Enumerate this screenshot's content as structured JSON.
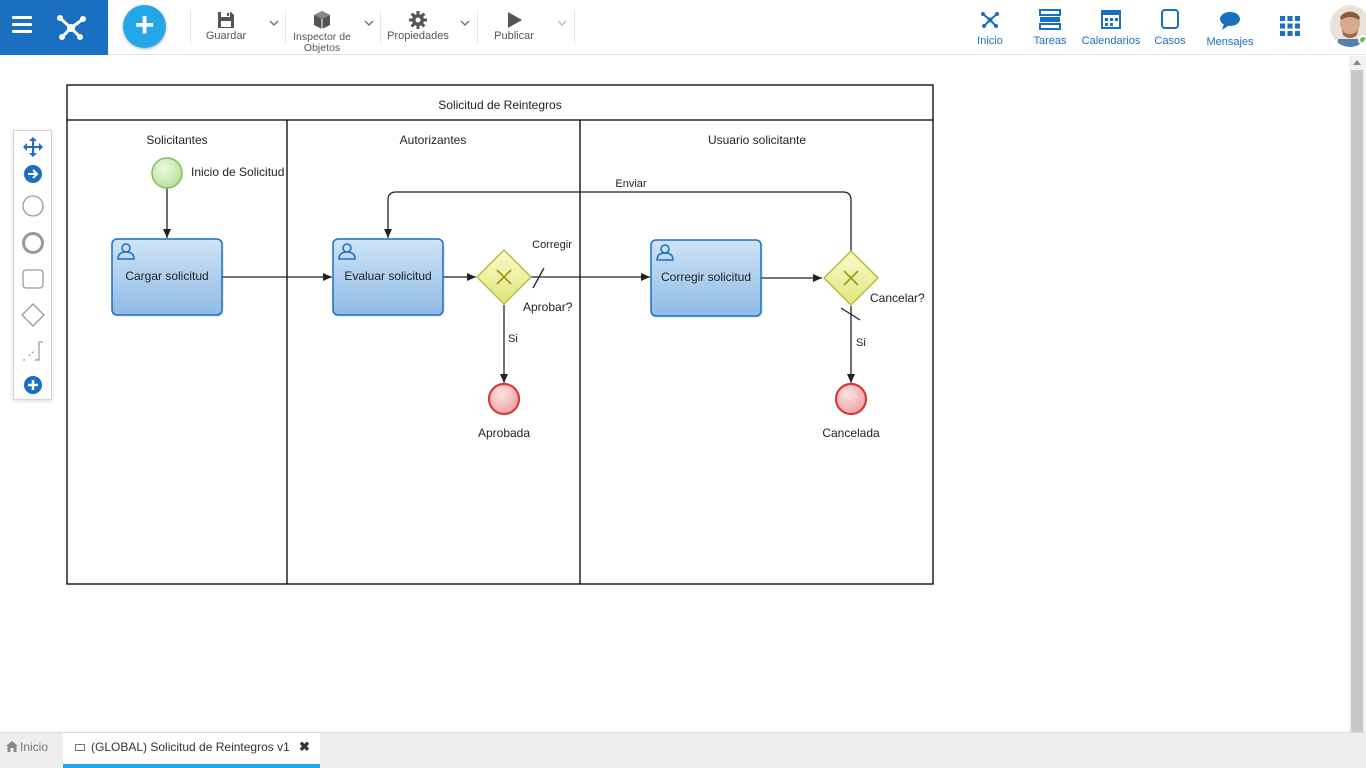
{
  "toolbar": {
    "save_label": "Guardar",
    "inspector_label": "Inspector de Objetos",
    "properties_label": "Propiedades",
    "publish_label": "Publicar",
    "add_label": "+"
  },
  "nav": {
    "home": "Inicio",
    "tasks": "Tareas",
    "calendars": "Calendarios",
    "cases": "Casos",
    "messages": "Mensajes"
  },
  "diagram": {
    "pool_title": "Solicitud de Reintegros",
    "lanes": [
      "Solicitantes",
      "Autorizantes",
      "Usuario solicitante"
    ],
    "start_event": "Inicio de Solicitud",
    "tasks": [
      "Cargar solicitud",
      "Evaluar solicitud",
      "Corregir solicitud"
    ],
    "gateways": [
      "Aprobar?",
      "Cancelar?"
    ],
    "end_events": [
      "Aprobada",
      "Cancelada"
    ],
    "flows": {
      "corregir": "Corregir",
      "si_1": "Si",
      "si_2": "Si",
      "enviar": "Enviar"
    }
  },
  "tabs": {
    "home": "Inicio",
    "document": "(GLOBAL) Solicitud de Reintegros v1"
  },
  "colors": {
    "brand": "#1a6fc0",
    "accent": "#24a7e8",
    "task_fill": "#a9cdee",
    "gateway_fill": "#f1f2a3",
    "start_fill": "#d4ebbf",
    "end_fill": "#f5b9b9"
  }
}
